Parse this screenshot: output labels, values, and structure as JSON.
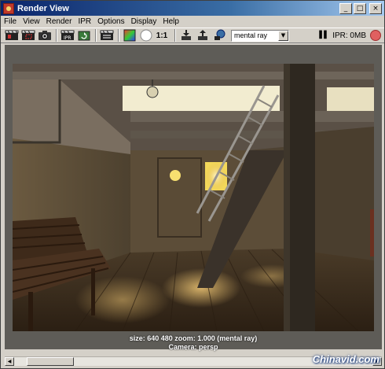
{
  "window": {
    "title": "Render View"
  },
  "titlebar_buttons": {
    "minimize": "_",
    "maximize": "□",
    "close": "×"
  },
  "menu": {
    "items": [
      "File",
      "View",
      "Render",
      "IPR",
      "Options",
      "Display",
      "Help"
    ]
  },
  "toolbar": {
    "ratio_label": "1:1",
    "renderer_value": "mental ray",
    "ipr_memory": "IPR: 0MB",
    "icons": [
      "redo-render-icon",
      "render-region-icon",
      "snapshot-icon",
      "ipr-render-icon",
      "refresh-ipr-icon",
      "render-settings-icon",
      "rgb-channels-icon",
      "alpha-channel-icon",
      "keep-image-icon",
      "remove-image-icon",
      "render-globals-icon"
    ]
  },
  "status": {
    "line1": "size:  640  480 zoom: 1.000      (mental ray)",
    "line2": "Camera: persp"
  },
  "watermark": "Chinavid.com",
  "colors": {
    "titlebar_start": "#0a246a",
    "window_bg": "#d4d0c8",
    "render_bg": "#5e5c57"
  }
}
